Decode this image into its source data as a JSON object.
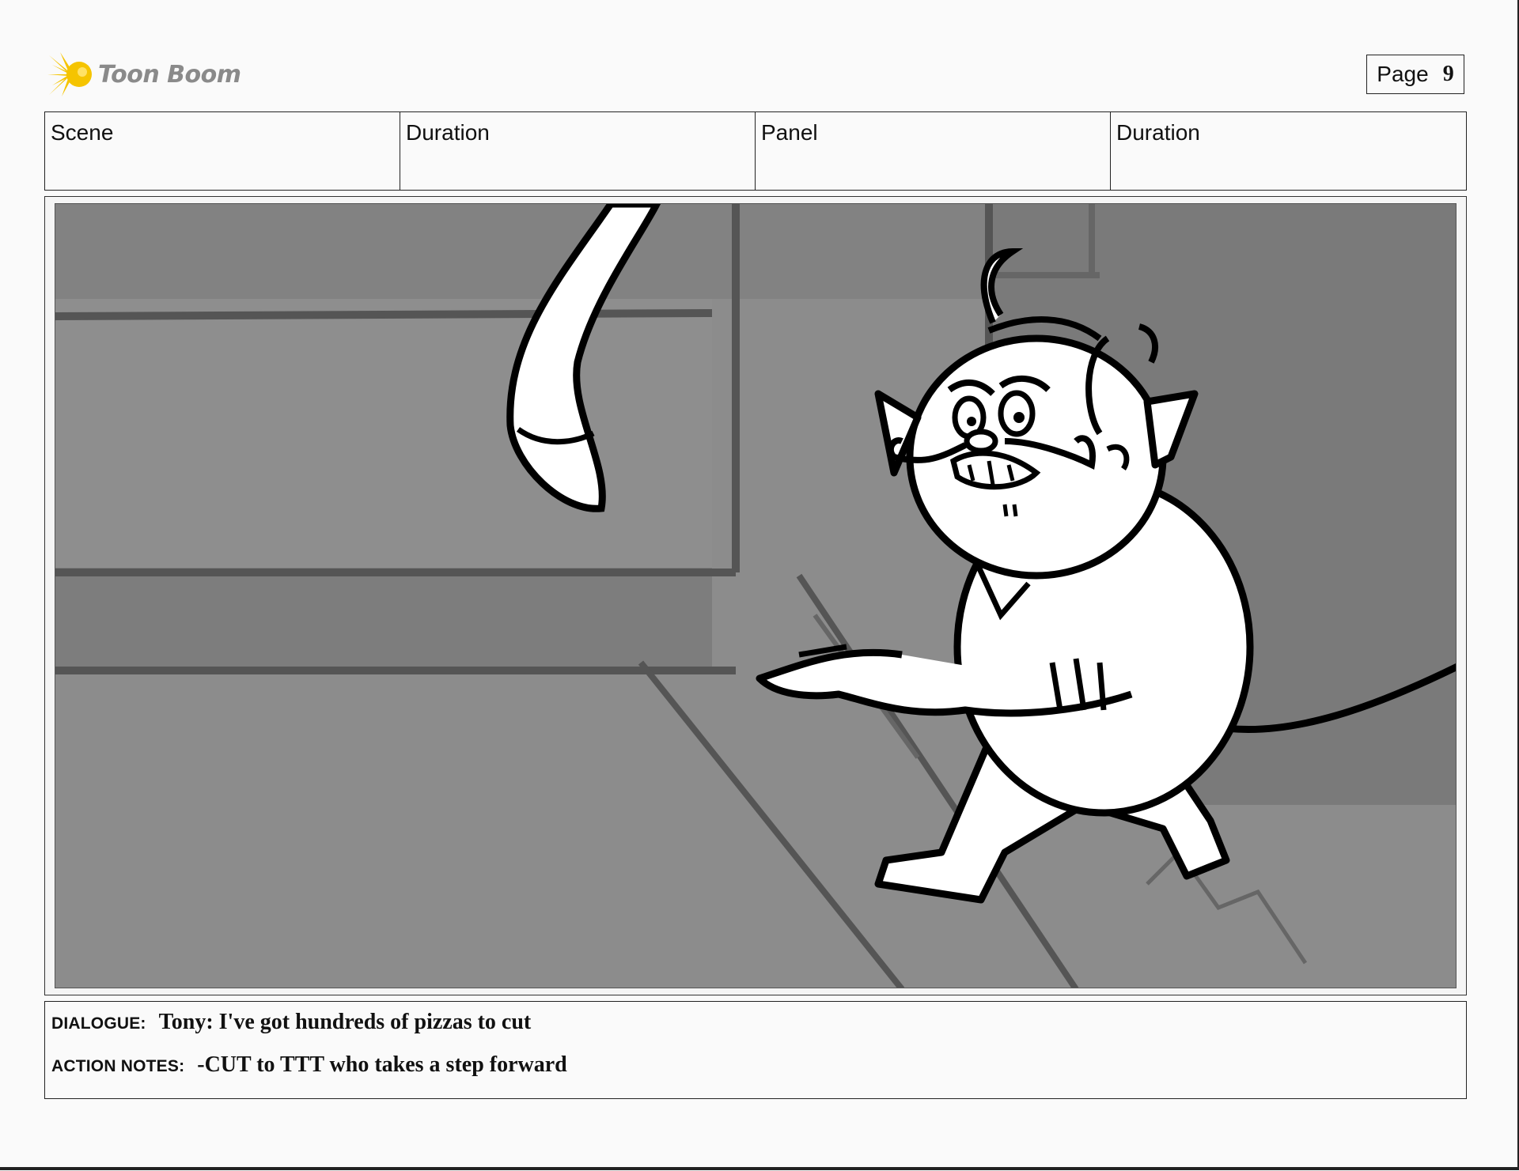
{
  "header": {
    "logo_text": "Toon Boom",
    "page_label": "Page",
    "page_number": "9"
  },
  "info_table": {
    "columns": [
      "Scene",
      "Duration",
      "Panel",
      "Duration"
    ]
  },
  "notes": {
    "dialogue_label": "DIALOGUE:",
    "dialogue_text": "Tony: I've got hundreds of pizzas to cut",
    "action_label": "ACTION NOTES:",
    "action_text": "-CUT to TTT who takes a step forward"
  },
  "colors": {
    "logo_accent": "#f5c400",
    "logo_text": "#8a8a8a",
    "panel_background": "#8a8a8a"
  },
  "icons": {
    "logo": "starburst-icon"
  }
}
